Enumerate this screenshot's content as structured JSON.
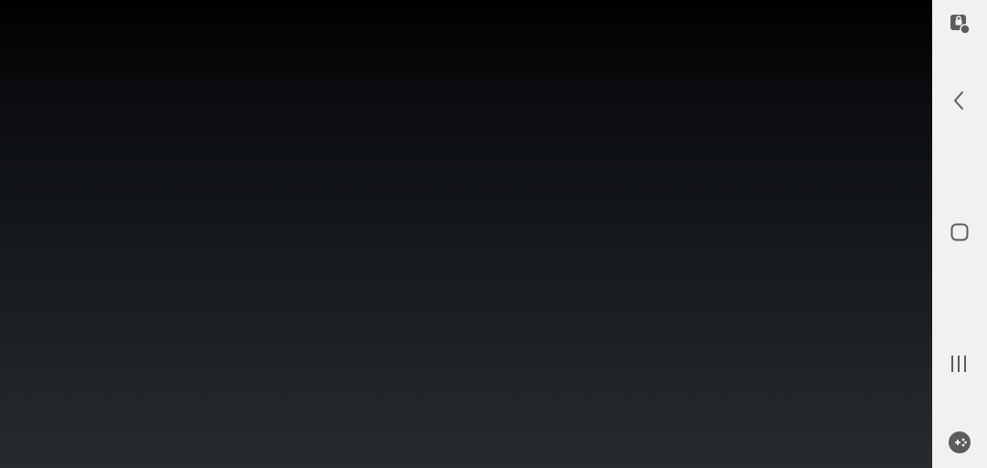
{
  "screen": {
    "background_top": "#000000",
    "background_bottom": "#272b2e"
  },
  "navbar": {
    "background": "#f1f1f1",
    "icon_color": "#5c5c5c",
    "buttons": [
      {
        "icon": "touch-lock-icon"
      },
      {
        "icon": "back-icon"
      },
      {
        "icon": "home-icon"
      },
      {
        "icon": "recent-apps-icon"
      },
      {
        "icon": "game-tools-icon"
      }
    ]
  }
}
